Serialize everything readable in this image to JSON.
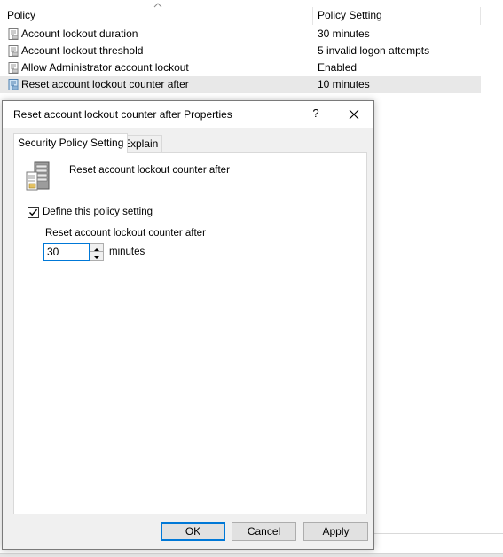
{
  "listview": {
    "columns": {
      "policy": "Policy",
      "setting": "Policy Setting"
    },
    "rows": [
      {
        "name": "Account lockout duration",
        "value": "30 minutes"
      },
      {
        "name": "Account lockout threshold",
        "value": "5 invalid logon attempts"
      },
      {
        "name": "Allow Administrator account lockout",
        "value": "Enabled"
      },
      {
        "name": "Reset account lockout counter after",
        "value": "10 minutes"
      }
    ],
    "selected_row_index": 3
  },
  "dialog": {
    "title": "Reset account lockout counter after Properties",
    "help_label": "?",
    "tabs": [
      {
        "label": "Security Policy Setting",
        "active": true
      },
      {
        "label": "Explain",
        "active": false
      }
    ],
    "policy_name": "Reset account lockout counter after",
    "define_checkbox": {
      "label": "Define this policy setting",
      "checked": true
    },
    "field_label": "Reset account lockout counter after",
    "field_value": "30",
    "unit_label": "minutes",
    "buttons": {
      "ok": "OK",
      "cancel": "Cancel",
      "apply": "Apply"
    }
  },
  "colors": {
    "accent": "#0078d7",
    "dialog_bg": "#f0f0f0",
    "selected_row": "#e8e8e8"
  },
  "icons": {
    "row_icon": "policy-doc-icon",
    "dialog_icon": "server-policy-icon",
    "close": "close-icon"
  }
}
